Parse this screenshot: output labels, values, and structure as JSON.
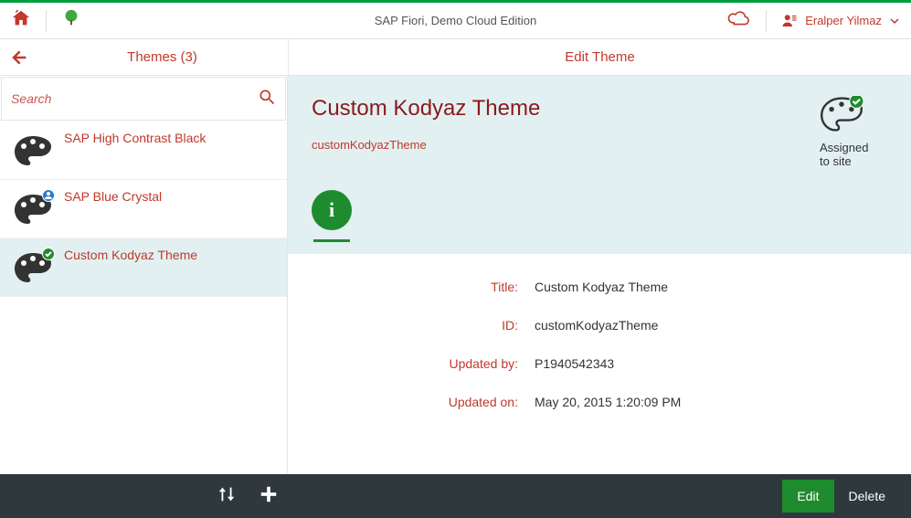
{
  "branding": {
    "title": "SAP Fiori, Demo Cloud Edition",
    "user": "Eralper Yilmaz"
  },
  "subheader": {
    "left_title": "Themes (3)",
    "right_title": "Edit Theme"
  },
  "search": {
    "placeholder": "Search"
  },
  "themes": [
    {
      "label": "SAP High Contrast Black"
    },
    {
      "label": "SAP Blue Crystal"
    },
    {
      "label": "Custom Kodyaz Theme"
    }
  ],
  "detail": {
    "title": "Custom Kodyaz Theme",
    "subtitle": "customKodyazTheme",
    "assigned_line1": "Assigned",
    "assigned_line2": "to site",
    "fields": {
      "title_label": "Title:",
      "title_value": "Custom Kodyaz Theme",
      "id_label": "ID:",
      "id_value": "customKodyazTheme",
      "updatedby_label": "Updated by:",
      "updatedby_value": "P1940542343",
      "updatedon_label": "Updated on:",
      "updatedon_value": "May 20, 2015 1:20:09 PM"
    }
  },
  "footer": {
    "edit": "Edit",
    "delete": "Delete"
  }
}
